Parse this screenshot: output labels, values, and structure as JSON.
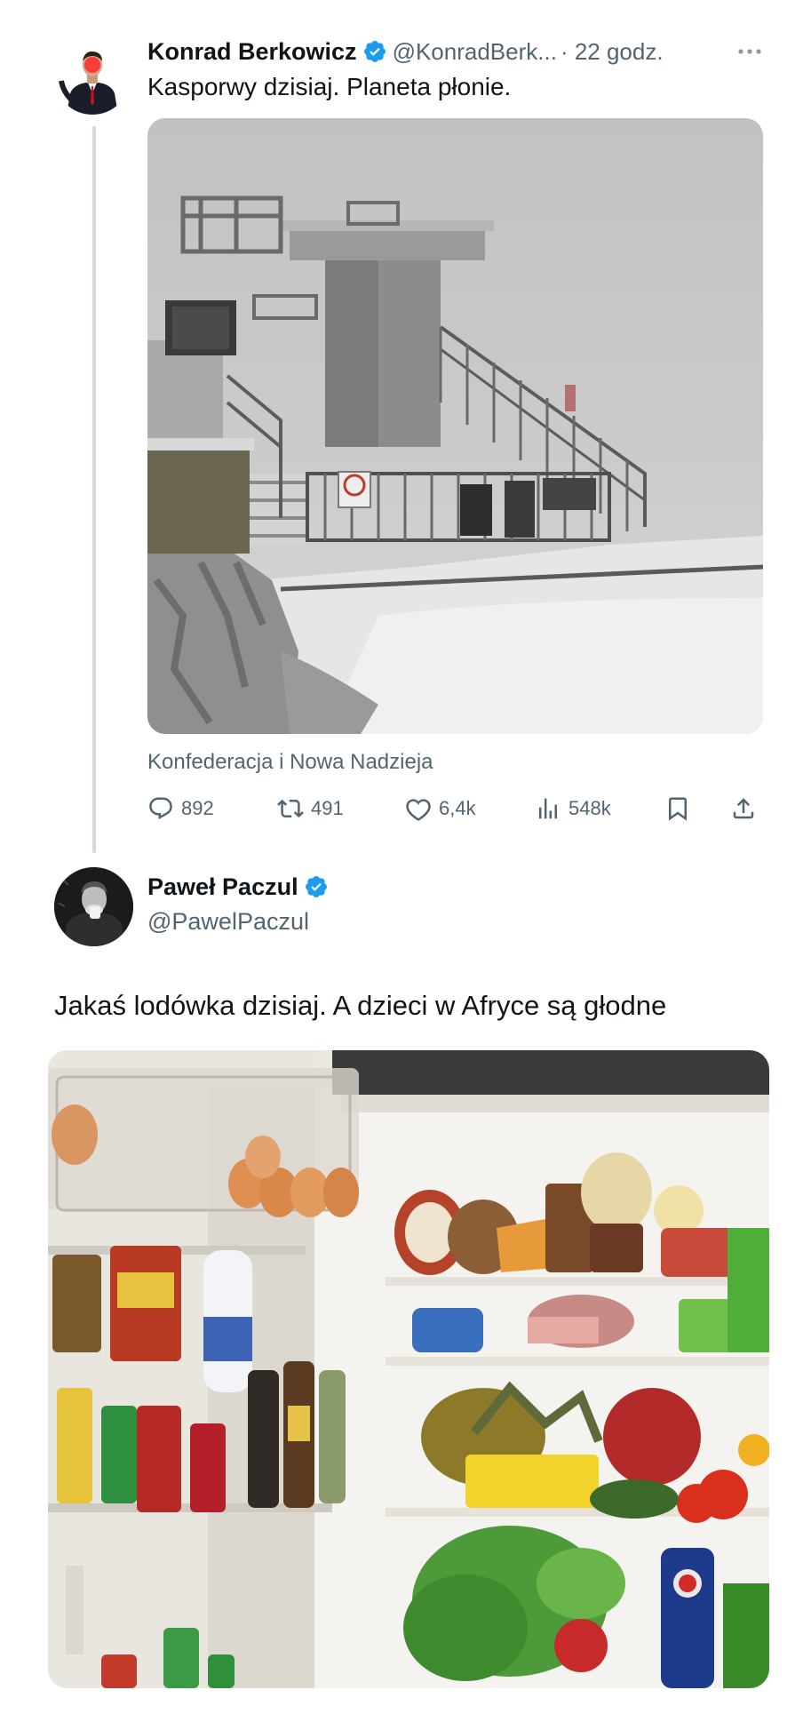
{
  "tweet1": {
    "author_name": "Konrad Berkowicz",
    "handle": "@KonradBerk...",
    "time": "· 22 godz.",
    "text": "Kasporwy dzisiaj. Planeta płonie.",
    "image_description": "snowy foggy ski lift station",
    "community": "Konfederacja i Nowa Nadzieja",
    "stats": {
      "replies": "892",
      "reposts": "491",
      "likes": "6,4k",
      "views": "548k"
    }
  },
  "tweet2": {
    "author_name": "Paweł Paczul",
    "handle": "@PawelPaczul",
    "text": "Jakaś lodówka dzisiaj. A dzieci w Afryce są głodne",
    "image_description": "open refrigerator full of food"
  },
  "colors": {
    "text": "#0f1419",
    "muted": "#536471",
    "verified": "#1d9bf0",
    "thread_line": "#cfd9de"
  },
  "icons": [
    "verified-badge-icon",
    "more-icon",
    "reply-icon",
    "repost-icon",
    "like-icon",
    "views-icon",
    "bookmark-icon",
    "share-icon"
  ]
}
